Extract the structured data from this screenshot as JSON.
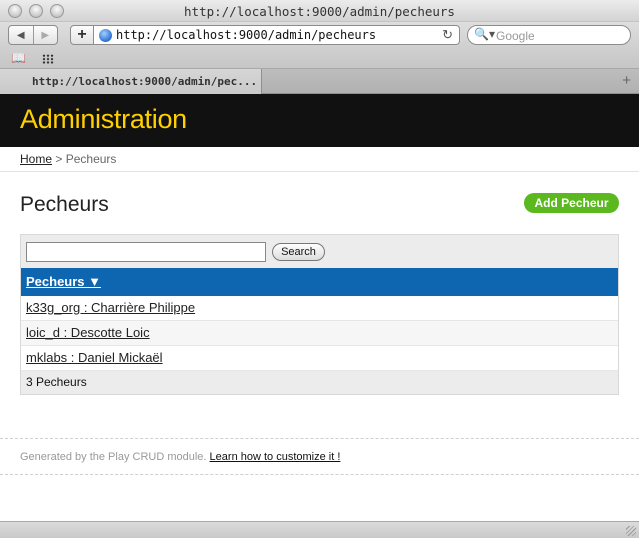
{
  "browser": {
    "window_title": "http://localhost:9000/admin/pecheurs",
    "url": "http://localhost:9000/admin/pecheurs",
    "search_placeholder": "Google",
    "tab_title": "http://localhost:9000/admin/pec..."
  },
  "header": {
    "title": "Administration",
    "title_color": "#ffd000"
  },
  "breadcrumb": {
    "home_label": "Home",
    "separator": ">",
    "current": "Pecheurs"
  },
  "page": {
    "title": "Pecheurs",
    "add_label": "Add Pecheur",
    "add_color": "#5bb81f"
  },
  "crud": {
    "search_value": "",
    "search_button": "Search",
    "column_header": "Pecheurs ▼",
    "header_color": "#0f66b0",
    "rows": [
      "k33g_org : Charrière Philippe",
      "loic_d : Descotte Loic",
      "mklabs : Daniel Mickaël"
    ],
    "count": "3 Pecheurs"
  },
  "footer": {
    "text": "Generated by the Play CRUD module.",
    "link": "Learn how to customize it !"
  }
}
